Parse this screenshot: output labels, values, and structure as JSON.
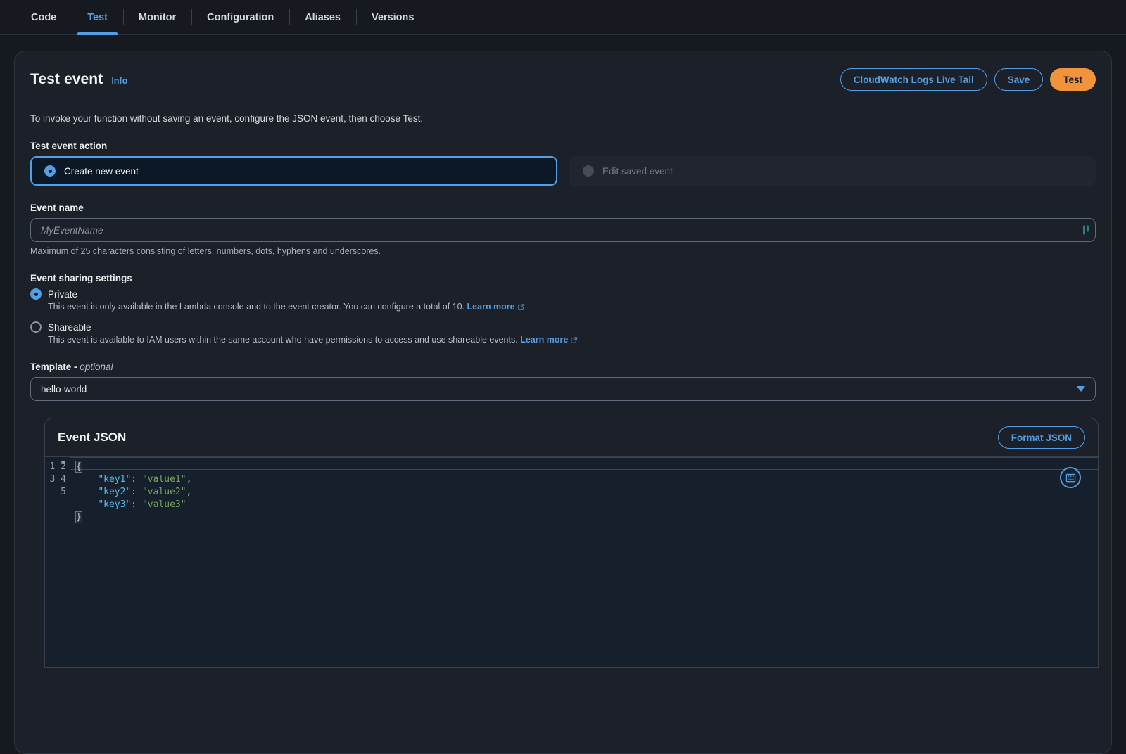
{
  "tabs": [
    {
      "label": "Code",
      "active": false
    },
    {
      "label": "Test",
      "active": true
    },
    {
      "label": "Monitor",
      "active": false
    },
    {
      "label": "Configuration",
      "active": false
    },
    {
      "label": "Aliases",
      "active": false
    },
    {
      "label": "Versions",
      "active": false
    }
  ],
  "panel": {
    "title": "Test event",
    "info_label": "Info",
    "intro": "To invoke your function without saving an event, configure the JSON event, then choose Test.",
    "actions": {
      "live_tail_label": "CloudWatch Logs Live Tail",
      "save_label": "Save",
      "test_label": "Test"
    }
  },
  "test_event_action": {
    "label": "Test event action",
    "options": [
      {
        "label": "Create new event",
        "selected": true,
        "disabled": false
      },
      {
        "label": "Edit saved event",
        "selected": false,
        "disabled": true
      }
    ]
  },
  "event_name": {
    "label": "Event name",
    "value": "",
    "placeholder": "MyEventName",
    "hint": "Maximum of 25 characters consisting of letters, numbers, dots, hyphens and underscores."
  },
  "sharing": {
    "label": "Event sharing settings",
    "options": [
      {
        "label": "Private",
        "selected": true,
        "description": "This event is only available in the Lambda console and to the event creator. You can configure a total of 10.",
        "learn_more": "Learn more"
      },
      {
        "label": "Shareable",
        "selected": false,
        "description": "This event is available to IAM users within the same account who have permissions to access and use shareable events.",
        "learn_more": "Learn more"
      }
    ]
  },
  "template": {
    "label": "Template -",
    "optional": "optional",
    "value": "hello-world"
  },
  "event_json": {
    "title": "Event JSON",
    "format_label": "Format JSON",
    "line_numbers": [
      "1",
      "2",
      "3",
      "4",
      "5"
    ],
    "lines": [
      "{",
      "    \"key1\": \"value1\",",
      "    \"key2\": \"value2\",",
      "    \"key3\": \"value3\"",
      "}"
    ],
    "keys": [
      "key1",
      "key2",
      "key3"
    ],
    "values": [
      "value1",
      "value2",
      "value3"
    ]
  },
  "colors": {
    "accent_blue": "#539fe5",
    "accent_orange": "#f0933b",
    "background": "#16191f",
    "panel": "#1b2029",
    "editor_bg": "#16202c",
    "json_key": "#54b9eb",
    "json_string": "#74a65d"
  }
}
